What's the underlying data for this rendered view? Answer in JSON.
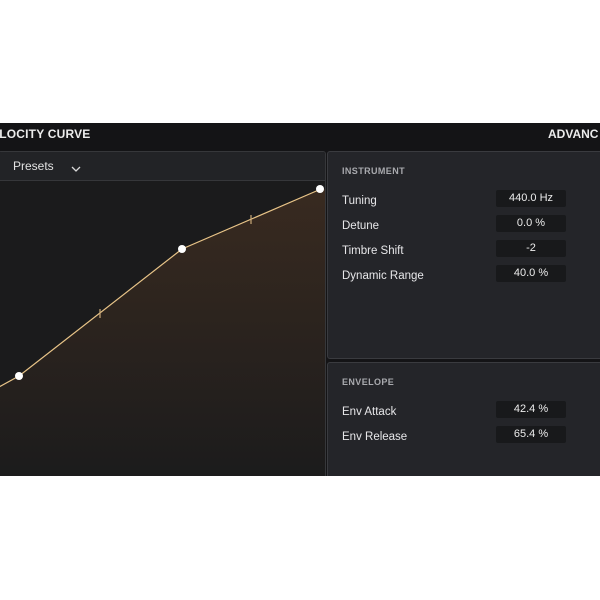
{
  "header": {
    "left_title": "ELOCITY CURVE",
    "right_title": "ADVANC"
  },
  "presets": {
    "label": "Presets"
  },
  "velocity_curve": {
    "line_color": "#e8c488",
    "points_visible": 4,
    "handles": [
      "point",
      "midpoint",
      "point",
      "midpoint",
      "point"
    ]
  },
  "instrument": {
    "title": "INSTRUMENT",
    "rows": [
      {
        "label": "Tuning",
        "value": "440.0 Hz"
      },
      {
        "label": "Detune",
        "value": "0.0 %"
      },
      {
        "label": "Timbre Shift",
        "value": "-2"
      },
      {
        "label": "Dynamic Range",
        "value": "40.0 %"
      }
    ]
  },
  "envelope": {
    "title": "ENVELOPE",
    "rows": [
      {
        "label": "Env Attack",
        "value": "42.4 %"
      },
      {
        "label": "Env Release",
        "value": "65.4 %"
      }
    ]
  }
}
